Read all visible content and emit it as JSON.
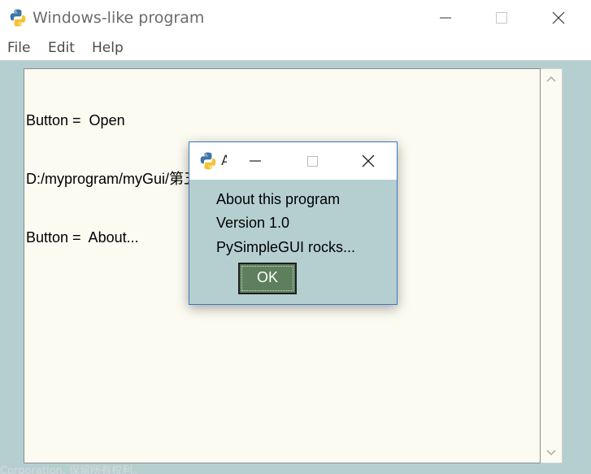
{
  "window": {
    "title": "Windows-like program",
    "controls": {
      "minimize": "minimize",
      "maximize": "maximize",
      "close": "close"
    }
  },
  "menu": {
    "items": [
      {
        "label": "File"
      },
      {
        "label": "Edit"
      },
      {
        "label": "Help"
      }
    ]
  },
  "output": {
    "lines": [
      "Button =  Open",
      "D:/myprogram/myGui/第五章/返回列表的打印显示.PNG",
      "Button =  About..."
    ]
  },
  "popup": {
    "title": "A",
    "lines": [
      "About this program",
      "Version 1.0",
      "PySimpleGUI rocks..."
    ],
    "ok_label": "OK"
  },
  "background_text": "Corporation. 保留所有权利。",
  "icons": {
    "app": "python-icon",
    "minimize": "minimize-icon",
    "maximize": "maximize-icon",
    "close": "close-icon",
    "scroll_up": "chevron-up-icon",
    "scroll_down": "chevron-down-icon"
  },
  "colors": {
    "window_bg": "#b5cfd1",
    "output_bg": "#fbfbf2",
    "ok_button_bg": "#5e7f5e",
    "popup_border": "#3c77c2"
  }
}
